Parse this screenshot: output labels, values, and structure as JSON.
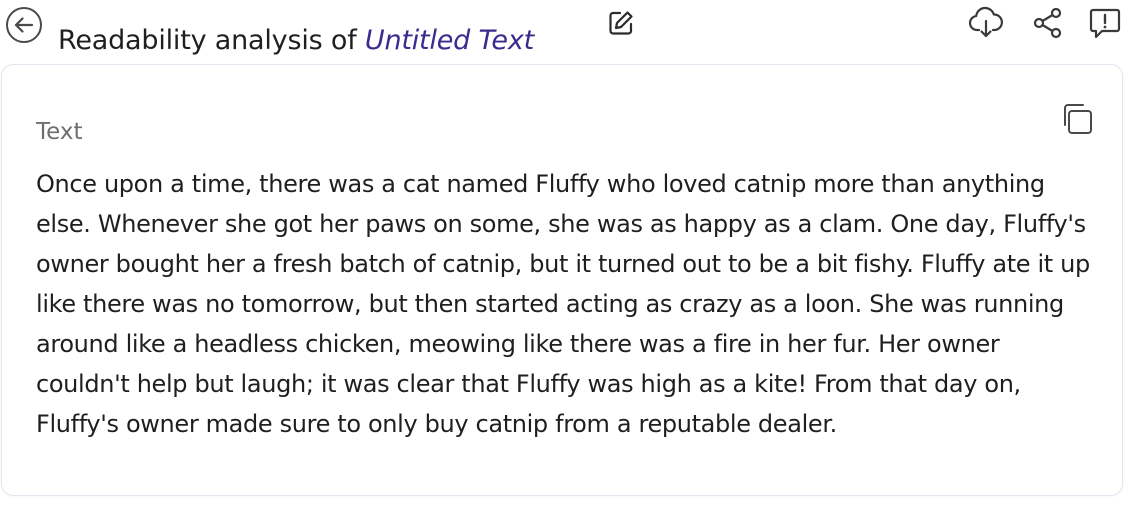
{
  "header": {
    "title_prefix": "Readability analysis of ",
    "document_name": "Untitled Text"
  },
  "icons": {
    "back": "arrow-left-circle-icon",
    "edit": "edit-pencil-icon",
    "download": "cloud-download-icon",
    "share": "share-icon",
    "feedback": "feedback-icon",
    "copy": "copy-icon"
  },
  "colors": {
    "accent": "#3d2a8f",
    "icon": "#4a4a4a",
    "label": "#6e6e6e",
    "border": "#e6e4f0"
  },
  "content": {
    "label": "Text",
    "text": "Once upon a time, there was a cat named Fluffy who loved catnip more than anything else. Whenever she got her paws on some, she was as happy as a clam. One day, Fluffy's owner bought her a fresh batch of catnip, but it turned out to be a bit fishy. Fluffy ate it up like there was no tomorrow, but then started acting as crazy as a loon. She was running around like a headless chicken, meowing like there was a fire in her fur. Her owner couldn't help but laugh; it was clear that Fluffy was high as a kite! From that day on, Fluffy's owner made sure to only buy catnip from a reputable dealer."
  }
}
